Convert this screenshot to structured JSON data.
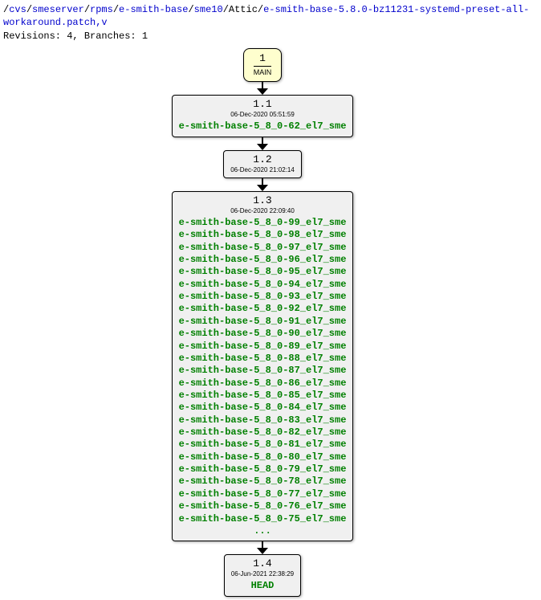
{
  "header": {
    "segments": [
      {
        "text": "cvs",
        "link": true
      },
      {
        "text": "smeserver",
        "link": true
      },
      {
        "text": "rpms",
        "link": true
      },
      {
        "text": "e-smith-base",
        "link": true
      },
      {
        "text": "sme10",
        "link": true
      },
      {
        "text": "Attic",
        "link": false
      },
      {
        "text": "e-smith-base-5.8.0-bz11231-systemd-preset-all-workaround.patch,v",
        "link": true
      }
    ],
    "revisions_label": "Revisions: ",
    "revisions": "4",
    "branches_label": ", Branches: ",
    "branches": "1"
  },
  "main": {
    "number": "1",
    "label": "MAIN"
  },
  "nodes": [
    {
      "rev": "1.1",
      "date": "06-Dec-2020 05:51:59",
      "tags": [
        "e-smith-base-5_8_0-62_el7_sme"
      ],
      "more": false
    },
    {
      "rev": "1.2",
      "date": "06-Dec-2020 21:02:14",
      "tags": [],
      "more": false
    },
    {
      "rev": "1.3",
      "date": "06-Dec-2020 22:09:40",
      "tags": [
        "e-smith-base-5_8_0-99_el7_sme",
        "e-smith-base-5_8_0-98_el7_sme",
        "e-smith-base-5_8_0-97_el7_sme",
        "e-smith-base-5_8_0-96_el7_sme",
        "e-smith-base-5_8_0-95_el7_sme",
        "e-smith-base-5_8_0-94_el7_sme",
        "e-smith-base-5_8_0-93_el7_sme",
        "e-smith-base-5_8_0-92_el7_sme",
        "e-smith-base-5_8_0-91_el7_sme",
        "e-smith-base-5_8_0-90_el7_sme",
        "e-smith-base-5_8_0-89_el7_sme",
        "e-smith-base-5_8_0-88_el7_sme",
        "e-smith-base-5_8_0-87_el7_sme",
        "e-smith-base-5_8_0-86_el7_sme",
        "e-smith-base-5_8_0-85_el7_sme",
        "e-smith-base-5_8_0-84_el7_sme",
        "e-smith-base-5_8_0-83_el7_sme",
        "e-smith-base-5_8_0-82_el7_sme",
        "e-smith-base-5_8_0-81_el7_sme",
        "e-smith-base-5_8_0-80_el7_sme",
        "e-smith-base-5_8_0-79_el7_sme",
        "e-smith-base-5_8_0-78_el7_sme",
        "e-smith-base-5_8_0-77_el7_sme",
        "e-smith-base-5_8_0-76_el7_sme",
        "e-smith-base-5_8_0-75_el7_sme"
      ],
      "more": true,
      "more_text": "..."
    },
    {
      "rev": "1.4",
      "date": "06-Jun-2021 22:38:29",
      "tags": [
        "HEAD"
      ],
      "more": false
    }
  ]
}
